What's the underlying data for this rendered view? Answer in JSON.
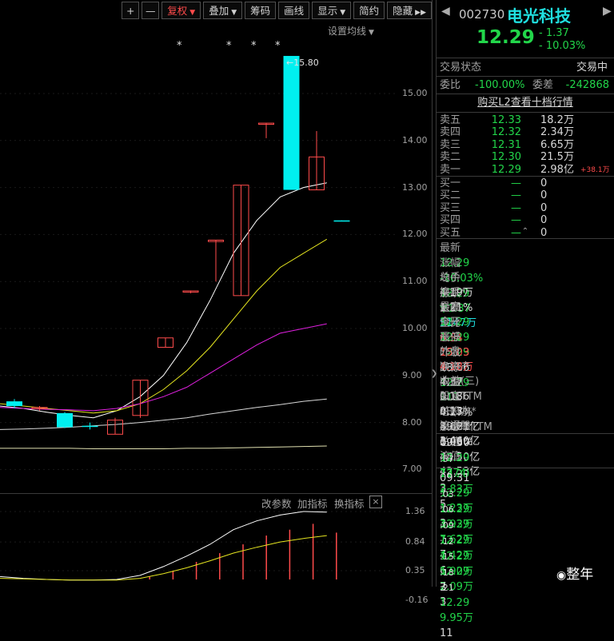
{
  "toolbar": {
    "plus": "+",
    "minus": "—",
    "fuquan": "复权",
    "diejia": "叠加",
    "chouma": "筹码",
    "huaxian": "画线",
    "xianshi": "显示",
    "jianyue": "简约",
    "yincang": "隐藏",
    "ma_setting": "设置均线"
  },
  "chart": {
    "price_axis": [
      "15.00",
      "14.00",
      "13.00",
      "12.00",
      "11.00",
      "10.00",
      "9.00",
      "8.00",
      "7.00"
    ],
    "high_marker": "15.80",
    "stars": [
      "*",
      "*",
      "*",
      "*"
    ],
    "sub_axis": [
      "1.36",
      "0.84",
      "0.35",
      "-0.16"
    ],
    "sub_head": {
      "params": "改参数",
      "add": "加指标",
      "switch": "换指标",
      "close": "×"
    },
    "candles": [
      {
        "o": 8.35,
        "c": 8.45,
        "h": 8.5,
        "l": 8.3,
        "color": "cyan"
      },
      {
        "o": 8.3,
        "c": 8.32,
        "h": 8.35,
        "l": 8.25,
        "color": "red"
      },
      {
        "o": 8.2,
        "c": 7.9,
        "h": 8.22,
        "l": 7.88,
        "color": "cyan"
      },
      {
        "o": 7.92,
        "c": 7.93,
        "h": 8.0,
        "l": 7.85,
        "color": "cyan"
      },
      {
        "o": 7.75,
        "c": 8.05,
        "h": 8.1,
        "l": 7.75,
        "color": "red"
      },
      {
        "o": 8.15,
        "c": 8.9,
        "h": 8.9,
        "l": 8.1,
        "color": "red"
      },
      {
        "o": 9.6,
        "c": 9.8,
        "h": 9.8,
        "l": 9.6,
        "color": "red"
      },
      {
        "o": 10.78,
        "c": 10.8,
        "h": 10.8,
        "l": 10.75,
        "color": "red"
      },
      {
        "o": 11.85,
        "c": 11.88,
        "h": 11.88,
        "l": 11.0,
        "color": "red"
      },
      {
        "o": 10.7,
        "c": 13.05,
        "h": 13.05,
        "l": 10.7,
        "color": "red"
      },
      {
        "o": 14.35,
        "c": 14.37,
        "h": 14.37,
        "l": 14.05,
        "color": "red"
      },
      {
        "o": 15.8,
        "c": 12.95,
        "h": 15.8,
        "l": 12.95,
        "color": "cyan"
      },
      {
        "o": 12.95,
        "c": 13.65,
        "h": 14.2,
        "l": 12.95,
        "color": "red"
      },
      {
        "o": 12.29,
        "c": 12.3,
        "h": 12.3,
        "l": 12.29,
        "color": "cyan"
      }
    ]
  },
  "quote": {
    "code": "002730",
    "name": "电光科技",
    "price": "12.29",
    "change": "- 1.37",
    "change_pct": "- 10.03%",
    "status_label": "交易状态",
    "status_value": "交易中",
    "weibi_label": "委比",
    "weibi_value": "-100.00%",
    "weicha_label": "委差",
    "weicha_value": "-242868",
    "l2_link": "购买L2查看十档行情",
    "sell": [
      {
        "label": "卖五",
        "price": "12.33",
        "vol": "18.2万",
        "extra": ""
      },
      {
        "label": "卖四",
        "price": "12.32",
        "vol": "2.34万",
        "extra": ""
      },
      {
        "label": "卖三",
        "price": "12.31",
        "vol": "6.65万",
        "extra": ""
      },
      {
        "label": "卖二",
        "price": "12.30",
        "vol": "21.5万",
        "extra": ""
      },
      {
        "label": "卖一",
        "price": "12.29",
        "vol": "2.98亿",
        "extra": "+38.1万"
      }
    ],
    "buy": [
      {
        "label": "买一",
        "price": "—",
        "vol": "0"
      },
      {
        "label": "买二",
        "price": "—",
        "vol": "0"
      },
      {
        "label": "买三",
        "price": "—",
        "vol": "0"
      },
      {
        "label": "买四",
        "price": "—",
        "vol": "0"
      },
      {
        "label": "买五",
        "price": "—",
        "vol": "0"
      }
    ],
    "stats": [
      {
        "l1": "最新",
        "v1": "12.29",
        "c1": "g",
        "l2": "均价",
        "v2": "12.29",
        "c2": "g"
      },
      {
        "l1": "涨幅",
        "v1": "-10.03%",
        "c1": "g",
        "l2": "涨跌",
        "v2": "▼1.37",
        "c2": "g"
      },
      {
        "l1": "总手",
        "v1": "4.19万",
        "c1": "w",
        "l2": "金额",
        "v2": "5147万",
        "c2": "c"
      },
      {
        "l1": "换手*",
        "v1": "1.21%",
        "c1": "w",
        "l2": "量比",
        "v2": "6.54",
        "c2": "r"
      },
      {
        "l1": "最高",
        "v1": "12.29",
        "c1": "g",
        "l2": "最低",
        "v2": "12.29",
        "c2": "g"
      },
      {
        "l1": "今开",
        "v1": "12.29",
        "c1": "g",
        "l2": "昨收",
        "v2": "13.66",
        "c2": "w"
      },
      {
        "l1": "涨停",
        "v1": "15.03",
        "c1": "r",
        "l2": "跌停",
        "v2": "12.29",
        "c2": "g"
      },
      {
        "l1": "外盘",
        "v1": "4.18万",
        "c1": "r",
        "l2": "内盘",
        "v2": "111",
        "c2": "g"
      },
      {
        "l1": "净资产",
        "v1": "4.37",
        "c1": "w",
        "l2": "ROE",
        "v2": "4.27%",
        "c2": "w"
      },
      {
        "l1": "收益(三)",
        "v1": "0.186",
        "c1": "w",
        "l2": "PE(动)*",
        "v2": "49.67",
        "c2": "w"
      },
      {
        "l1": "股息TTM",
        "v1": "0.13",
        "c1": "w",
        "l2": "股息率TTM",
        "v2": "1.06%",
        "c2": "w"
      },
      {
        "l1": "总股本",
        "v1": "3.621亿",
        "c1": "w",
        "l2": "总值",
        "v2": "44.50亿",
        "c2": "w"
      },
      {
        "l1": "流通股",
        "v1": "3.460亿",
        "c1": "w",
        "l2": "流值",
        "v2": "42.53亿",
        "c2": "w"
      }
    ],
    "ticks": [
      {
        "t": "09:30",
        "p": "12.29",
        "v": "7374",
        "n": "3"
      },
      {
        "t": ":57",
        "p": "12.29",
        "v": "2.83万",
        "n": "5"
      },
      {
        "t": "09:31",
        "p": "12.29",
        "v": "1.23万",
        "n": "3"
      },
      {
        "t": ":03",
        "p": "12.29",
        "v": "3.93万",
        "n": "7"
      },
      {
        "t": ":06",
        "p": "12.29",
        "v": "7.62万",
        "n": "7"
      },
      {
        "t": ":09",
        "p": "12.29",
        "v": "4.42万",
        "n": "6"
      },
      {
        "t": ":12",
        "p": "12.29",
        "v": "5.90万",
        "n": "7"
      },
      {
        "t": ":15",
        "p": "12.29",
        "v": "2.09万",
        "n": "3"
      },
      {
        "t": ":18",
        "p": "",
        "v": "",
        "n": "3"
      },
      {
        "t": ":21",
        "p": "12.29",
        "v": "9.95万",
        "n": "11"
      }
    ],
    "watermark": "整年"
  }
}
